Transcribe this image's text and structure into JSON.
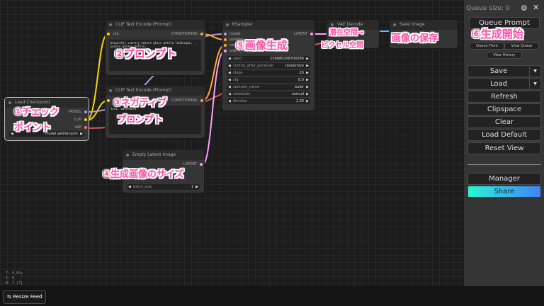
{
  "nodes": {
    "checkpoint": {
      "title": "Load Checkpoint",
      "outputs": [
        "MODEL",
        "CLIP",
        "VAE"
      ],
      "ckpt_value": "model.safetensors"
    },
    "clip_pos": {
      "title": "CLIP Text Encode (Prompt)",
      "input": "clip",
      "output": "CONDITIONING",
      "text": "beautiful scenery nature glass bottle landscape, , purple galaxy bottle,"
    },
    "clip_neg": {
      "title": "CLIP Text Encode (Prompt)",
      "input": "clip",
      "output": "CONDITIONING",
      "text": "text, watermark"
    },
    "ksampler": {
      "title": "KSampler",
      "inputs": [
        "model",
        "positive",
        "negative",
        "latent_image"
      ],
      "output": "LATENT",
      "widgets": [
        {
          "name": "seed",
          "value": "156680208700286"
        },
        {
          "name": "control_after_generate",
          "value": "randomize"
        },
        {
          "name": "steps",
          "value": "20"
        },
        {
          "name": "cfg",
          "value": "8.0"
        },
        {
          "name": "sampler_name",
          "value": "euler"
        },
        {
          "name": "scheduler",
          "value": "normal"
        },
        {
          "name": "denoise",
          "value": "1.00"
        }
      ]
    },
    "vae_decode": {
      "title": "VAE Decode"
    },
    "save_image": {
      "title": "Save Image"
    },
    "empty_latent": {
      "title": "Empty Latent Image",
      "output": "LATENT",
      "widgets": [
        {
          "name": "batch_size",
          "value": "1"
        }
      ]
    }
  },
  "annotations": {
    "checkpoint": "①チェック\nポイント",
    "prompt": "②プロンプト",
    "negative": "③ネガティブ\nプロンプト",
    "latent_size": "④生成画像のサイズ",
    "generate": "⑤画像生成",
    "decode_line1": "潜在空間→",
    "decode_line2": "ピクセル空間",
    "save": "画像の保存",
    "start": "⑥生成開始"
  },
  "stats": {
    "line1": "T: 0.00s",
    "line2": "I: 0",
    "line3": "N: 7 [7]"
  },
  "bottom": {
    "resize_label": "⇆ Resize Feed"
  },
  "panel": {
    "queue_size": "Queue size: 0",
    "queue_prompt": "Queue Prompt",
    "queue_front": "Queue Front",
    "view_queue": "View Queue",
    "view_history": "View History",
    "save": "Save",
    "load": "Load",
    "refresh": "Refresh",
    "clipspace": "Clipspace",
    "clear": "Clear",
    "load_default": "Load Default",
    "reset_view": "Reset View",
    "manager": "Manager",
    "share": "Share"
  },
  "colors": {
    "model": "#b39ddb",
    "clip": "#ffd500",
    "vae": "#ff6e6e",
    "conditioning": "#ffa931",
    "latent": "#ff9cf9",
    "image": "#64b5f6",
    "annotation": "#ff50a8"
  },
  "icons": {
    "gear": "gear-icon",
    "close": "close-icon",
    "dropdown": "chevron-down-icon",
    "left_arrow": "left-arrow-icon",
    "right_arrow": "right-arrow-icon"
  }
}
